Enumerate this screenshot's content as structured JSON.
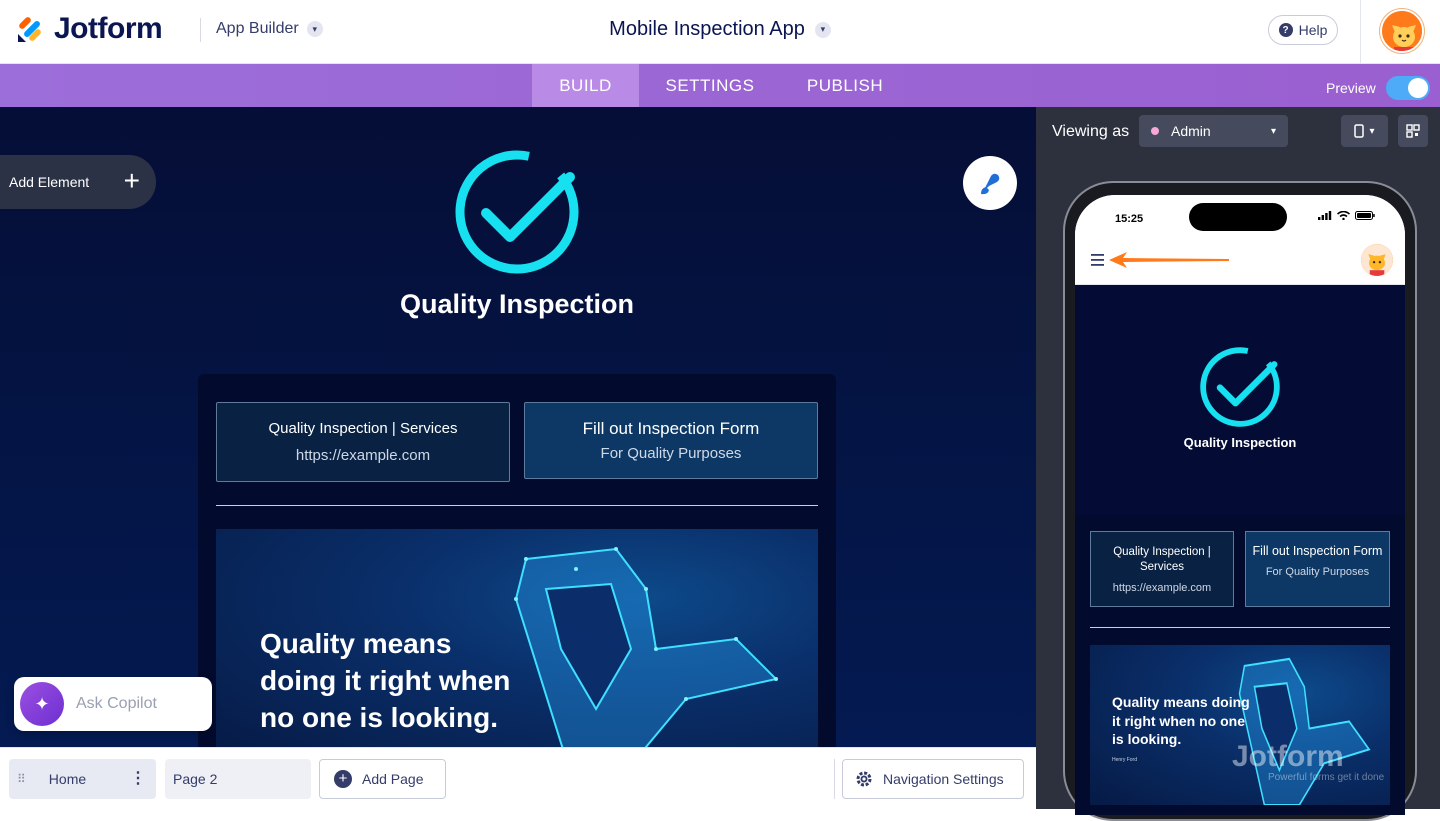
{
  "header": {
    "logo_text": "Jotform",
    "app_builder": "App Builder",
    "app_title": "Mobile Inspection App",
    "help": "Help"
  },
  "nav": {
    "tabs": [
      "BUILD",
      "SETTINGS",
      "PUBLISH"
    ],
    "active_tab": "BUILD",
    "preview_label": "Preview",
    "preview_on": true
  },
  "canvas": {
    "add_element": "Add Element",
    "hero_title": "Quality Inspection",
    "links": [
      {
        "title": "Quality Inspection | Services",
        "subtitle": "https://example.com"
      },
      {
        "title": "Fill out Inspection Form",
        "subtitle": "For Quality Purposes"
      }
    ],
    "banner_text": "Quality means doing it right when no one is looking."
  },
  "copilot": {
    "label": "Ask Copilot"
  },
  "pages": {
    "items": [
      "Home",
      "Page 2"
    ],
    "add_page": "Add Page",
    "navigation_settings": "Navigation Settings"
  },
  "preview_panel": {
    "viewing_as_label": "Viewing as",
    "role": "Admin",
    "phone_time": "15:25",
    "hero_title": "Quality Inspection",
    "links": [
      {
        "title": "Quality Inspection | Services",
        "subtitle": "https://example.com"
      },
      {
        "title": "Fill out Inspection Form",
        "subtitle": "For Quality Purposes"
      }
    ],
    "banner_text": "Quality means doing it right when no one is looking.",
    "banner_author": "Henry Ford"
  },
  "watermark": {
    "brand": "Jotform",
    "tagline": "Powerful forms get it done"
  },
  "colors": {
    "accent_purple": "#9c6ed9",
    "canvas_bg": "#041a52",
    "check_cyan": "#17e0f0",
    "toggle_blue": "#4dabf7",
    "arrow_orange": "#ff7a1a"
  },
  "icons": {
    "logo": "jotform-logo-icon",
    "help": "question-icon",
    "add": "plus-icon",
    "brush": "paint-brush-icon",
    "copilot": "sparkle-icon",
    "settings": "gear-icon",
    "device": "phone-icon",
    "qr": "qr-code-icon",
    "menu": "hamburger-icon"
  }
}
